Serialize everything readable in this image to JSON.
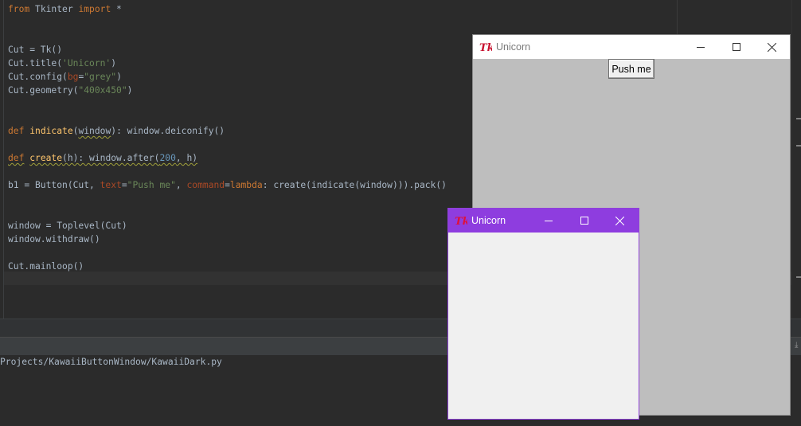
{
  "ide": {
    "code_lines": [
      [
        {
          "t": "from",
          "c": "kw"
        },
        {
          "t": " Tkinter "
        },
        {
          "t": "import",
          "c": "kw"
        },
        {
          "t": " *"
        }
      ],
      [],
      [],
      [
        {
          "t": "Cut = Tk()"
        }
      ],
      [
        {
          "t": "Cut.title("
        },
        {
          "t": "'Unicorn'",
          "c": "str"
        },
        {
          "t": ")"
        }
      ],
      [
        {
          "t": "Cut.config("
        },
        {
          "t": "bg",
          "c": "param"
        },
        {
          "t": "="
        },
        {
          "t": "\"grey\"",
          "c": "str"
        },
        {
          "t": ")"
        }
      ],
      [
        {
          "t": "Cut.geometry("
        },
        {
          "t": "\"400x450\"",
          "c": "str"
        },
        {
          "t": ")"
        }
      ],
      [],
      [],
      [
        {
          "t": "def",
          "c": "kw"
        },
        {
          "t": " "
        },
        {
          "t": "indicate",
          "c": "fn"
        },
        {
          "t": "("
        },
        {
          "t": "window",
          "c": "squig"
        },
        {
          "t": "): window.deiconify()"
        }
      ],
      [],
      [
        {
          "t": "def",
          "c": "kw squig"
        },
        {
          "t": " "
        },
        {
          "t": "create",
          "c": "fn squig"
        },
        {
          "t": "(h): window.after(",
          "c": "squig"
        },
        {
          "t": "200",
          "c": "num squig"
        },
        {
          "t": ", h)",
          "c": "squig"
        }
      ],
      [],
      [
        {
          "t": "b1 = Button(Cut, "
        },
        {
          "t": "text",
          "c": "param"
        },
        {
          "t": "="
        },
        {
          "t": "\"Push me\"",
          "c": "str"
        },
        {
          "t": ", "
        },
        {
          "t": "command",
          "c": "param"
        },
        {
          "t": "="
        },
        {
          "t": "lambda",
          "c": "kw"
        },
        {
          "t": ": create(indicate(window))).pack()"
        }
      ],
      [],
      [],
      [
        {
          "t": "window = Toplevel(Cut)"
        }
      ],
      [
        {
          "t": "window.withdraw()"
        }
      ],
      [],
      [
        {
          "t": "Cut.mainloop()"
        }
      ]
    ],
    "console_path": "Projects/KawaiiButtonWindow/KawaiiDark.py"
  },
  "main_window": {
    "title": "Unicorn",
    "button_label": "Push me",
    "bg_color": "#bebebe"
  },
  "toplevel_window": {
    "title": "Unicorn",
    "titlebar_color": "#8e3ddf"
  },
  "icons": {
    "app": "tk-feather-icon",
    "minimize": "minimize-icon",
    "maximize": "maximize-icon",
    "close": "close-icon"
  }
}
